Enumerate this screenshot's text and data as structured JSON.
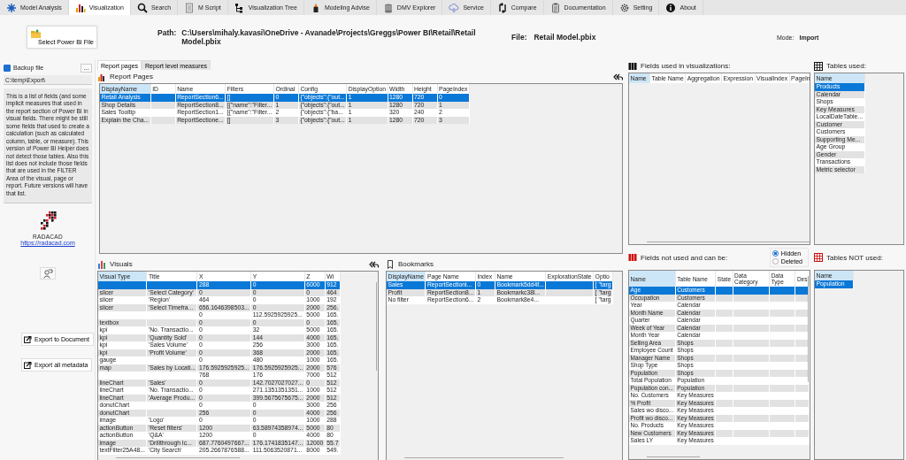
{
  "tabs": [
    {
      "label": "Model Analysis",
      "selected": false
    },
    {
      "label": "Visualization",
      "selected": true
    },
    {
      "label": "Search",
      "selected": false
    },
    {
      "label": "M Script",
      "selected": false
    },
    {
      "label": "Visualization Tree",
      "selected": false
    },
    {
      "label": "Modeling Advise",
      "selected": false
    },
    {
      "label": "DMV Explorer",
      "selected": false
    },
    {
      "label": "Service",
      "selected": false
    },
    {
      "label": "Compare",
      "selected": false
    },
    {
      "label": "Documentation",
      "selected": false
    },
    {
      "label": "Setting",
      "selected": false
    },
    {
      "label": "About",
      "selected": false
    }
  ],
  "select_file_button": "Select Power BI File",
  "path": {
    "label": "Path:",
    "value": "C:\\Users\\mihaly.kavasi\\OneDrive - Avanade\\Projects\\Greggs\\Power BI\\Retail\\Retail Model.pbix"
  },
  "file": {
    "label": "File:",
    "value": "Retail Model.pbix"
  },
  "mode": {
    "label": "Mode:",
    "value": "Import"
  },
  "left_panel": {
    "backup": {
      "label": "Backup file",
      "checked": true
    },
    "browse_button": "...",
    "export_path": "C:\\temp\\Export\\",
    "description": "This is a list of fields (and some implicit measures that used in the report section of Power BI in visual fields. There might be still some fields that used to create a calculation (such as calculated column, table, or measure). This version of Power BI Helper does not detect those tables. Also this list does not include those fields that are used in the FILTER Area of the visual, page or report. Future versions will have that list.",
    "logo_text": "RADACAD",
    "link": "https://radacad.com",
    "export_buttons": [
      "Export to Document",
      "Export all metadata"
    ]
  },
  "subtabs": [
    {
      "label": "Report pages",
      "selected": true
    },
    {
      "label": "Report level measures",
      "selected": false
    }
  ],
  "report_pages": {
    "title": "Report Pages",
    "columns": [
      "DisplayName",
      "ID",
      "Name",
      "Filters",
      "Ordinal",
      "Config",
      "DisplayOption",
      "Width",
      "Height",
      "PageIndex"
    ],
    "rows": [
      {
        "selected": true,
        "cells": [
          "Retail Analysis",
          null,
          "ReportSection6...",
          "[]",
          "0",
          "{\"objects\":{\"out...",
          "1",
          "1280",
          "720",
          "0"
        ]
      },
      {
        "selected": false,
        "cells": [
          "Shop Details",
          null,
          "ReportSection8...",
          "[{\"name\":\"Filter...",
          "1",
          "{\"objects\":{\"out...",
          "1",
          "1280",
          "720",
          "1"
        ]
      },
      {
        "selected": false,
        "cells": [
          "Sales Tooltip",
          null,
          "ReportSection1...",
          "[{\"name\":\"Filter...",
          "2",
          "{\"objects\":{\"ba...",
          "1",
          "320",
          "240",
          "2"
        ]
      },
      {
        "selected": false,
        "cells": [
          "Explain the Cha...",
          null,
          "ReportSectione...",
          "[]",
          "3",
          "{\"objects\":{\"out...",
          "1",
          "1280",
          "720",
          "3"
        ]
      }
    ]
  },
  "visuals": {
    "title": "Visuals",
    "columns": [
      "Visual Type",
      "Title",
      "X",
      "Y",
      "Z",
      "Wi"
    ],
    "rows": [
      {
        "selected": true,
        "cells": [
          null,
          null,
          "288",
          "0",
          "6000",
          "912"
        ]
      },
      {
        "selected": false,
        "cells": [
          "slicer",
          "'Select Category'",
          "0",
          "0",
          "0",
          "464"
        ]
      },
      {
        "selected": false,
        "cells": [
          "slicer",
          "'Region'",
          "464",
          "0",
          "1000",
          "192"
        ]
      },
      {
        "selected": false,
        "cells": [
          "slicer",
          "'Select Timefra...",
          "656.1646398503...",
          "0",
          "2000",
          "256."
        ]
      },
      {
        "selected": false,
        "cells": [
          null,
          null,
          "0",
          "112.5925925925...",
          "5000",
          "165."
        ]
      },
      {
        "selected": false,
        "cells": [
          "textbox",
          null,
          "0",
          "0",
          "0",
          "165."
        ]
      },
      {
        "selected": false,
        "cells": [
          "kpi",
          "'No. Transactio...",
          "0",
          "32",
          "5000",
          "165."
        ]
      },
      {
        "selected": false,
        "cells": [
          "kpi",
          "'Quantity Sold'",
          "0",
          "144",
          "4000",
          "165."
        ]
      },
      {
        "selected": false,
        "cells": [
          "kpi",
          "'Sales Volume'",
          "0",
          "256",
          "3000",
          "165."
        ]
      },
      {
        "selected": false,
        "cells": [
          "kpi",
          "'Profit Volume'",
          "0",
          "368",
          "2000",
          "165."
        ]
      },
      {
        "selected": false,
        "cells": [
          "gauge",
          null,
          "0",
          "480",
          "1000",
          "165."
        ]
      },
      {
        "selected": false,
        "cells": [
          "map",
          "'Sales by Locati...",
          "176.5925925925...",
          "176.5925925925...",
          "2000",
          "576"
        ]
      },
      {
        "selected": false,
        "cells": [
          null,
          null,
          "768",
          "176",
          "7000",
          "512"
        ]
      },
      {
        "selected": false,
        "cells": [
          "lineChart",
          "'Sales'",
          "0",
          "142.7027027027...",
          "0",
          "512"
        ]
      },
      {
        "selected": false,
        "cells": [
          "lineChart",
          "'No. Transactio...",
          "0",
          "271.1351351351...",
          "1000",
          "512"
        ]
      },
      {
        "selected": false,
        "cells": [
          "lineChart",
          "'Average Produ...",
          "0",
          "399.5675675675...",
          "2000",
          "512"
        ]
      },
      {
        "selected": false,
        "cells": [
          "donutChart",
          null,
          "0",
          "0",
          "3000",
          "256"
        ]
      },
      {
        "selected": false,
        "cells": [
          "donutChart",
          null,
          "256",
          "0",
          "4000",
          "256"
        ]
      },
      {
        "selected": false,
        "cells": [
          "image",
          "'Logo'",
          "0",
          "0",
          "1000",
          "288"
        ]
      },
      {
        "selected": false,
        "cells": [
          "actionButton",
          "'Reset filters'",
          "1200",
          "63.58974358974...",
          "5000",
          "80"
        ]
      },
      {
        "selected": false,
        "cells": [
          "actionButton",
          "'Q&A'",
          "1200",
          "0",
          "4000",
          "80"
        ]
      },
      {
        "selected": false,
        "cells": [
          "image",
          "'Drillthrough Ic...",
          "687.7760497667...",
          "176.1741835147...",
          "12000",
          "55.7"
        ]
      },
      {
        "selected": false,
        "cells": [
          "textFilter25A48...",
          "'City Search'",
          "205.2667876588...",
          "111.5063520871...",
          "8000",
          "549."
        ]
      }
    ]
  },
  "bookmarks": {
    "title": "Bookmarks",
    "columns": [
      "DisplayName",
      "Page Name",
      "Index",
      "Name",
      "ExplorationState",
      "Optio"
    ],
    "rows": [
      {
        "selected": true,
        "cells": [
          "Sales",
          "ReportSectionl...",
          "0",
          "Bookmark5dd4f...",
          null,
          "[ \"targ"
        ]
      },
      {
        "selected": false,
        "cells": [
          "Profit",
          "ReportSection8...",
          "1",
          "Bookmarkc38l...",
          null,
          "[ \"targ"
        ]
      },
      {
        "selected": false,
        "cells": [
          "No filter",
          "ReportSection6...",
          "2",
          "Bookmark8e4...",
          null,
          "[ \"targ"
        ]
      }
    ]
  },
  "fields_used": {
    "title": "Fields used in visualizations:",
    "columns": [
      "Name",
      "Table Name",
      "Aggregation",
      "Expression",
      "VisualIndex",
      "PageIn"
    ]
  },
  "tables_used": {
    "title": "Tables used:",
    "columns": [
      "Name"
    ],
    "rows": [
      {
        "selected": true,
        "cells": [
          "Products"
        ]
      },
      {
        "selected": false,
        "cells": [
          "Calendar"
        ]
      },
      {
        "selected": false,
        "cells": [
          "Shops"
        ]
      },
      {
        "selected": false,
        "cells": [
          "Key Measures"
        ]
      },
      {
        "selected": false,
        "cells": [
          "LocalDateTable..."
        ]
      },
      {
        "selected": false,
        "cells": [
          "Customer"
        ]
      },
      {
        "selected": false,
        "cells": [
          "Customers"
        ]
      },
      {
        "selected": false,
        "cells": [
          "Supporting Me..."
        ]
      },
      {
        "selected": false,
        "cells": [
          "Age Group"
        ]
      },
      {
        "selected": false,
        "cells": [
          "Gender"
        ]
      },
      {
        "selected": false,
        "cells": [
          "Transactions"
        ]
      },
      {
        "selected": false,
        "cells": [
          "Metric selector"
        ]
      }
    ]
  },
  "fields_not_used": {
    "title": "Fields not used and can be:",
    "options": [
      {
        "label": "Hidden",
        "selected": true
      },
      {
        "label": "Deleted",
        "selected": false
      }
    ],
    "columns": [
      "Name",
      "Table Name",
      "State",
      "Data Category",
      "Data Type",
      "Des"
    ],
    "rows": [
      {
        "selected": true,
        "cells": [
          "Age",
          "Customers",
          null,
          null,
          null,
          null
        ]
      },
      {
        "selected": false,
        "cells": [
          "Occupation",
          "Customers",
          null,
          null,
          null,
          null
        ]
      },
      {
        "selected": false,
        "cells": [
          "Year",
          "Calendar",
          null,
          null,
          null,
          null
        ]
      },
      {
        "selected": false,
        "cells": [
          "Month Name",
          "Calendar",
          null,
          null,
          null,
          null
        ]
      },
      {
        "selected": false,
        "cells": [
          "Quarter",
          "Calendar",
          null,
          null,
          null,
          null
        ]
      },
      {
        "selected": false,
        "cells": [
          "Week of Year",
          "Calendar",
          null,
          null,
          null,
          null
        ]
      },
      {
        "selected": false,
        "cells": [
          "Month Year",
          "Calendar",
          null,
          null,
          null,
          null
        ]
      },
      {
        "selected": false,
        "cells": [
          "Selling Area",
          "Shops",
          null,
          null,
          null,
          null
        ]
      },
      {
        "selected": false,
        "cells": [
          "Employee Count",
          "Shops",
          null,
          null,
          null,
          null
        ]
      },
      {
        "selected": false,
        "cells": [
          "Manager Name",
          "Shops",
          null,
          null,
          null,
          null
        ]
      },
      {
        "selected": false,
        "cells": [
          "Shop Type",
          "Shops",
          null,
          null,
          null,
          null
        ]
      },
      {
        "selected": false,
        "cells": [
          "Population",
          "Shops",
          null,
          null,
          null,
          null
        ]
      },
      {
        "selected": false,
        "cells": [
          "Total Population",
          "Population",
          null,
          null,
          null,
          null
        ]
      },
      {
        "selected": false,
        "cells": [
          "Population con...",
          "Population",
          null,
          null,
          null,
          null
        ]
      },
      {
        "selected": false,
        "cells": [
          "No. Customers",
          "Key Measures",
          null,
          null,
          null,
          null
        ]
      },
      {
        "selected": false,
        "cells": [
          "% Profit",
          "Key Measures",
          null,
          null,
          null,
          null
        ]
      },
      {
        "selected": false,
        "cells": [
          "Sales wo disco...",
          "Key Measures",
          null,
          null,
          null,
          null
        ]
      },
      {
        "selected": false,
        "cells": [
          "Profit wo disco...",
          "Key Measures",
          null,
          null,
          null,
          null
        ]
      },
      {
        "selected": false,
        "cells": [
          "No. Products",
          "Key Measures",
          null,
          null,
          null,
          null
        ]
      },
      {
        "selected": false,
        "cells": [
          "New Customers",
          "Key Measures",
          null,
          null,
          null,
          null
        ]
      },
      {
        "selected": false,
        "cells": [
          "Sales LY",
          "Key Measures",
          null,
          null,
          null,
          null
        ]
      }
    ]
  },
  "tables_not_used": {
    "title": "Tables NOT used:",
    "columns": [
      "Name"
    ],
    "rows": [
      {
        "selected": true,
        "cells": [
          "Population"
        ]
      }
    ]
  }
}
